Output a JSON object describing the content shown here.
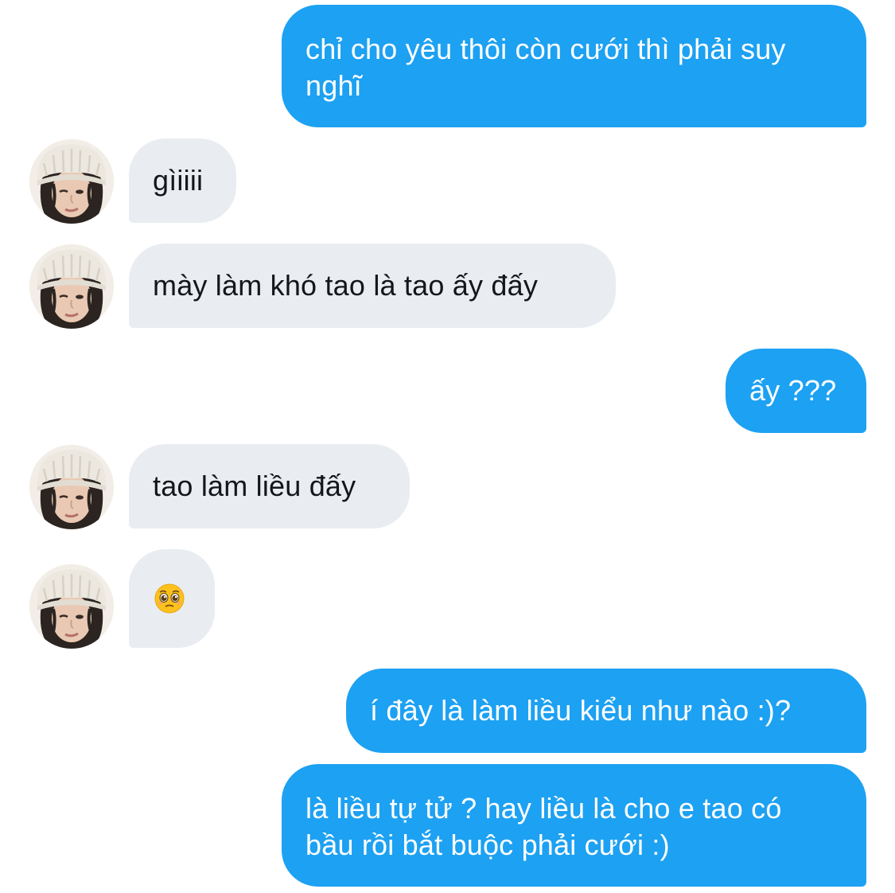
{
  "conversation": {
    "messages": [
      {
        "side": "sent",
        "text": "chỉ cho yêu thôi còn cưới thì phải suy nghĩ"
      },
      {
        "side": "received",
        "text": "gìiiii"
      },
      {
        "side": "received",
        "text": "mày làm khó tao là tao ấy đấy"
      },
      {
        "side": "sent",
        "text": "ấy ???"
      },
      {
        "side": "received",
        "text": "tao làm liều đấy"
      },
      {
        "side": "received",
        "emoji": "pleading-face-emoji"
      },
      {
        "side": "sent",
        "text": "í đây là làm liều kiểu như nào :)?"
      },
      {
        "side": "sent",
        "text": "là liều tự tử ? hay liều là cho e tao có bầu rồi bắt buộc phải cưới :)"
      }
    ]
  },
  "colors": {
    "sent_bubble": "#1da1f2",
    "received_bubble": "#e9edf1",
    "sent_text": "#ffffff",
    "received_text": "#14171a"
  },
  "icons": {
    "avatar": "user-avatar-beanie",
    "emoji": "pleading-face-emoji"
  }
}
